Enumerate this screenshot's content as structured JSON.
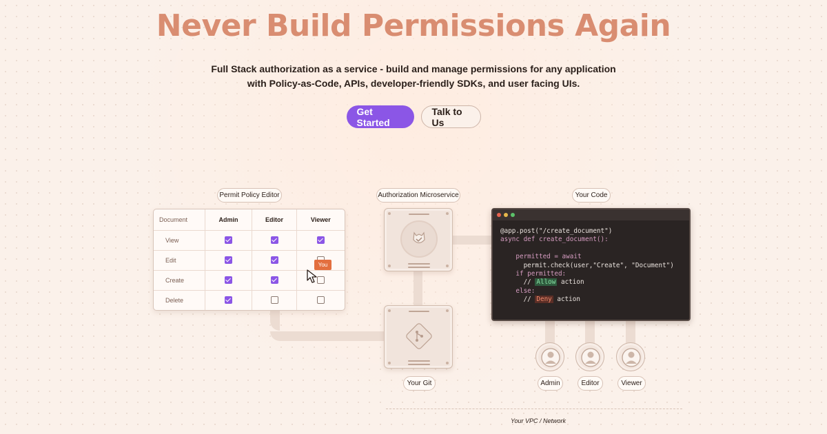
{
  "hero": {
    "title": "Never Build Permissions Again",
    "subtitle_line1": "Full Stack authorization as a service - build and manage permissions for any application",
    "subtitle_line2": "with Policy-as-Code, APIs, developer-friendly SDKs, and user facing UIs."
  },
  "cta": {
    "primary_label": "Get Started",
    "secondary_label": "Talk to Us"
  },
  "labels": {
    "policy_editor": "Permit Policy Editor",
    "microservice": "Authorization Microservice",
    "your_code": "Your Code",
    "your_git": "Your Git",
    "network": "Your VPC / Network"
  },
  "policy_table": {
    "resource": "Document",
    "roles": [
      "Admin",
      "Editor",
      "Viewer"
    ],
    "rows": [
      {
        "action": "View",
        "checks": [
          true,
          true,
          true
        ]
      },
      {
        "action": "Edit",
        "checks": [
          true,
          true,
          false
        ]
      },
      {
        "action": "Create",
        "checks": [
          true,
          true,
          false
        ]
      },
      {
        "action": "Delete",
        "checks": [
          true,
          false,
          false
        ]
      }
    ],
    "cursor_tag": "You"
  },
  "code": {
    "line1": "@app.post(\"/create_document\")",
    "line2": "async def create_document():",
    "line3": "    permitted = await",
    "line4": "      permit.check(user,\"Create\", \"Document\")",
    "line5": "    if permitted:",
    "line6_prefix": "      // ",
    "line6_tag": "Allow",
    "line6_suffix": " action",
    "line7": "    else:",
    "line8_prefix": "      // ",
    "line8_tag": "Deny",
    "line8_suffix": " action"
  },
  "users": [
    "Admin",
    "Editor",
    "Viewer"
  ],
  "colors": {
    "accent": "#8b56e6",
    "title": "#d98d71",
    "you_tag": "#e36f3f"
  }
}
